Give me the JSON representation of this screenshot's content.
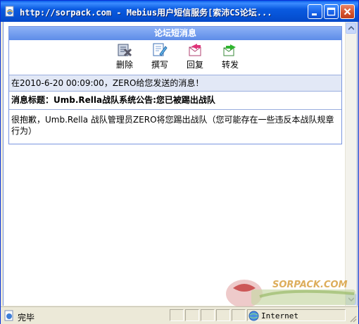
{
  "window": {
    "title": "http://sorpack.com - Mebius用户短信服务[索沛CS论坛...",
    "controls": [
      "minimize",
      "maximize",
      "close"
    ]
  },
  "panel": {
    "header": "论坛短消息",
    "toolbar": [
      {
        "label": "删除",
        "icon": "delete-icon"
      },
      {
        "label": "撰写",
        "icon": "compose-icon"
      },
      {
        "label": "回复",
        "icon": "reply-icon"
      },
      {
        "label": "转发",
        "icon": "forward-icon"
      }
    ],
    "info_line": "在2010-6-20 00:09:00，ZERO给您发送的消息！",
    "subject_line": "消息标题：Umb.Rella战队系统公告:您已被踢出战队",
    "body": "很抱歉，Umb.Rella 战队管理员ZERO将您踢出战队（您可能存在一些违反本战队规章行为）"
  },
  "watermark": {
    "text": "SORPACK.COM"
  },
  "statusbar": {
    "status": "完毕",
    "zone": "Internet"
  },
  "colors": {
    "titlebar": "#0a5ae0",
    "panel_header": "#6f99ea",
    "info_row_bg": "#e2e8f6",
    "border": "#7a96df"
  }
}
